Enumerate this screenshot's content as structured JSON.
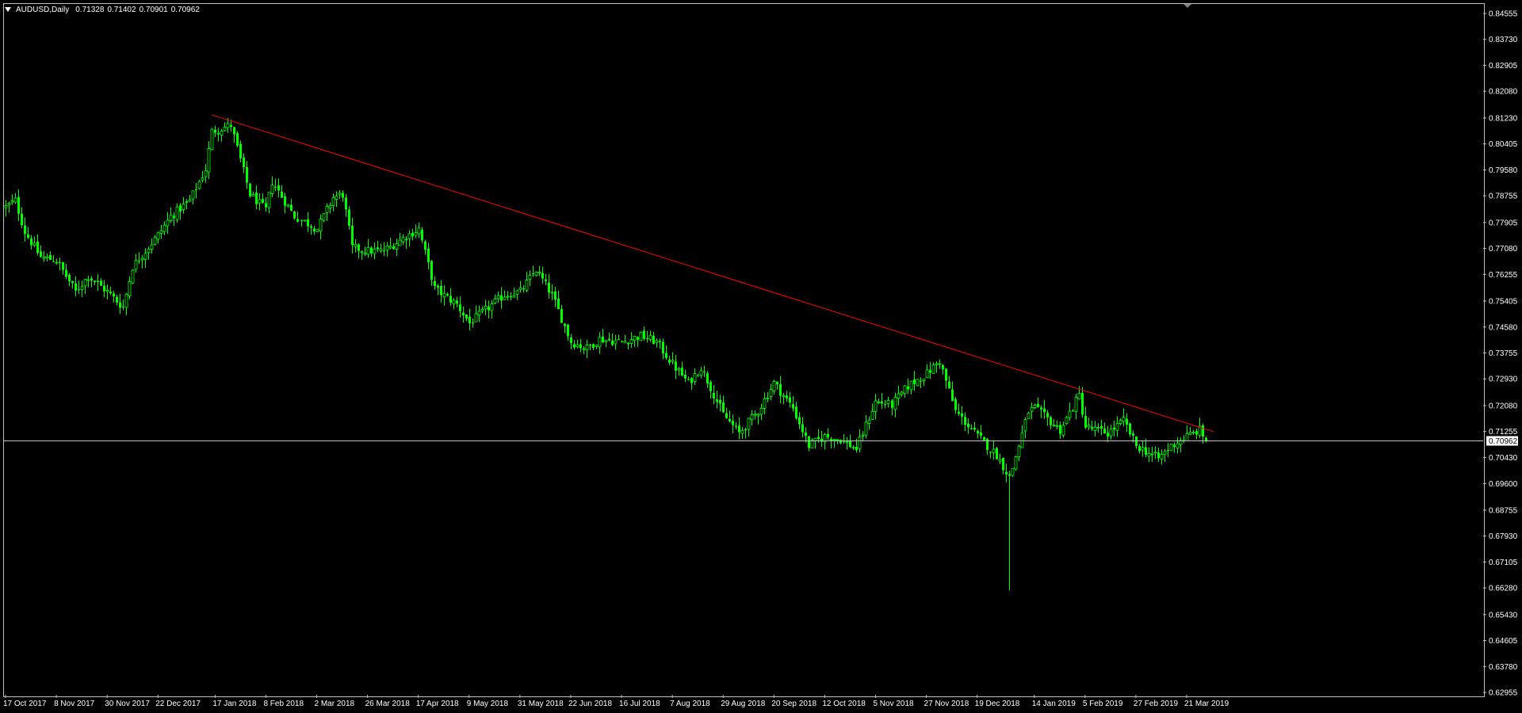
{
  "window": {
    "symbol": "AUDUSD,Daily",
    "ohlc": [
      "0.71328",
      "0.71402",
      "0.70901",
      "0.70962"
    ]
  },
  "colors": {
    "background": "#000000",
    "candle": "#00ff00",
    "trendline": "#ff0000",
    "price_line": "#c0c0c0",
    "frame": "#c0c0c0",
    "price_label_bg": "#ffffff",
    "price_label_text": "#000000"
  },
  "chart_data": {
    "type": "candlestick",
    "y_ticks": [
      "0.84555",
      "0.83730",
      "0.82905",
      "0.82080",
      "0.81230",
      "0.80405",
      "0.79580",
      "0.78755",
      "0.77905",
      "0.77080",
      "0.76255",
      "0.75405",
      "0.74580",
      "0.73755",
      "0.72930",
      "0.72080",
      "0.71255",
      "0.70430",
      "0.69600",
      "0.68755",
      "0.67930",
      "0.67105",
      "0.66280",
      "0.65430",
      "0.64605",
      "0.63780",
      "0.62955"
    ],
    "ylim": [
      0.62955,
      0.84555
    ],
    "x_ticks": [
      "17 Oct 2017",
      "8 Nov 2017",
      "30 Nov 2017",
      "22 Dec 2017",
      "17 Jan 2018",
      "8 Feb 2018",
      "2 Mar 2018",
      "26 Mar 2018",
      "17 Apr 2018",
      "9 May 2018",
      "31 May 2018",
      "22 Jun 2018",
      "16 Jul 2018",
      "7 Aug 2018",
      "29 Aug 2018",
      "20 Sep 2018",
      "12 Oct 2018",
      "5 Nov 2018",
      "27 Nov 2018",
      "19 Dec 2018",
      "14 Jan 2019",
      "5 Feb 2019",
      "27 Feb 2019",
      "21 Mar 2019"
    ],
    "current_price": "0.70962",
    "trendline": {
      "start": {
        "date": "16 Jan 2018",
        "price": 0.8133
      },
      "end": {
        "date": "29 Mar 2019",
        "price": 0.7125
      }
    },
    "price_path": [
      {
        "date": "17 Oct 2017",
        "close": 0.784
      },
      {
        "date": "20 Oct 2017",
        "close": 0.786
      },
      {
        "date": "25 Oct 2017",
        "close": 0.776
      },
      {
        "date": "1 Nov 2017",
        "close": 0.768
      },
      {
        "date": "8 Nov 2017",
        "close": 0.767
      },
      {
        "date": "16 Nov 2017",
        "close": 0.757
      },
      {
        "date": "22 Nov 2017",
        "close": 0.762
      },
      {
        "date": "30 Nov 2017",
        "close": 0.757
      },
      {
        "date": "7 Dec 2017",
        "close": 0.752
      },
      {
        "date": "12 Dec 2017",
        "close": 0.765
      },
      {
        "date": "22 Dec 2017",
        "close": 0.775
      },
      {
        "date": "28 Dec 2017",
        "close": 0.781
      },
      {
        "date": "5 Jan 2018",
        "close": 0.786
      },
      {
        "date": "12 Jan 2018",
        "close": 0.796
      },
      {
        "date": "16 Jan 2018",
        "close": 0.808
      },
      {
        "date": "24 Jan 2018",
        "close": 0.81
      },
      {
        "date": "1 Feb 2018",
        "close": 0.788
      },
      {
        "date": "8 Feb 2018",
        "close": 0.783
      },
      {
        "date": "12 Feb 2018",
        "close": 0.792
      },
      {
        "date": "21 Feb 2018",
        "close": 0.781
      },
      {
        "date": "2 Mar 2018",
        "close": 0.777
      },
      {
        "date": "9 Mar 2018",
        "close": 0.787
      },
      {
        "date": "14 Mar 2018",
        "close": 0.788
      },
      {
        "date": "19 Mar 2018",
        "close": 0.771
      },
      {
        "date": "26 Mar 2018",
        "close": 0.77
      },
      {
        "date": "2 Apr 2018",
        "close": 0.77
      },
      {
        "date": "10 Apr 2018",
        "close": 0.774
      },
      {
        "date": "17 Apr 2018",
        "close": 0.777
      },
      {
        "date": "24 Apr 2018",
        "close": 0.758
      },
      {
        "date": "3 May 2018",
        "close": 0.753
      },
      {
        "date": "9 May 2018",
        "close": 0.747
      },
      {
        "date": "17 May 2018",
        "close": 0.752
      },
      {
        "date": "24 May 2018",
        "close": 0.756
      },
      {
        "date": "31 May 2018",
        "close": 0.757
      },
      {
        "date": "7 Jun 2018",
        "close": 0.764
      },
      {
        "date": "14 Jun 2018",
        "close": 0.756
      },
      {
        "date": "22 Jun 2018",
        "close": 0.741
      },
      {
        "date": "29 Jun 2018",
        "close": 0.739
      },
      {
        "date": "5 Jul 2018",
        "close": 0.742
      },
      {
        "date": "16 Jul 2018",
        "close": 0.741
      },
      {
        "date": "24 Jul 2018",
        "close": 0.743
      },
      {
        "date": "31 Jul 2018",
        "close": 0.741
      },
      {
        "date": "7 Aug 2018",
        "close": 0.734
      },
      {
        "date": "14 Aug 2018",
        "close": 0.728
      },
      {
        "date": "20 Aug 2018",
        "close": 0.733
      },
      {
        "date": "29 Aug 2018",
        "close": 0.718
      },
      {
        "date": "5 Sep 2018",
        "close": 0.712
      },
      {
        "date": "13 Sep 2018",
        "close": 0.719
      },
      {
        "date": "20 Sep 2018",
        "close": 0.728
      },
      {
        "date": "28 Sep 2018",
        "close": 0.72
      },
      {
        "date": "5 Oct 2018",
        "close": 0.708
      },
      {
        "date": "12 Oct 2018",
        "close": 0.711
      },
      {
        "date": "19 Oct 2018",
        "close": 0.71
      },
      {
        "date": "26 Oct 2018",
        "close": 0.707
      },
      {
        "date": "5 Nov 2018",
        "close": 0.722
      },
      {
        "date": "12 Nov 2018",
        "close": 0.721
      },
      {
        "date": "19 Nov 2018",
        "close": 0.727
      },
      {
        "date": "27 Nov 2018",
        "close": 0.731
      },
      {
        "date": "3 Dec 2018",
        "close": 0.735
      },
      {
        "date": "10 Dec 2018",
        "close": 0.719
      },
      {
        "date": "19 Dec 2018",
        "close": 0.711
      },
      {
        "date": "27 Dec 2018",
        "close": 0.705
      },
      {
        "date": "2 Jan 2019",
        "close": 0.698
      },
      {
        "date": "3 Jan 2019",
        "close": 0.701
      },
      {
        "date": "10 Jan 2019",
        "close": 0.719
      },
      {
        "date": "14 Jan 2019",
        "close": 0.72
      },
      {
        "date": "24 Jan 2019",
        "close": 0.713
      },
      {
        "date": "1 Feb 2019",
        "close": 0.724
      },
      {
        "date": "5 Feb 2019",
        "close": 0.714
      },
      {
        "date": "14 Feb 2019",
        "close": 0.712
      },
      {
        "date": "21 Feb 2019",
        "close": 0.716
      },
      {
        "date": "27 Feb 2019",
        "close": 0.708
      },
      {
        "date": "8 Mar 2019",
        "close": 0.704
      },
      {
        "date": "14 Mar 2019",
        "close": 0.708
      },
      {
        "date": "21 Mar 2019",
        "close": 0.711
      },
      {
        "date": "27 Mar 2019",
        "close": 0.713
      },
      {
        "date": "29 Mar 2019",
        "close": 0.7096
      }
    ],
    "spikes": [
      {
        "date": "2 Jan 2019",
        "low": 0.662
      }
    ]
  }
}
